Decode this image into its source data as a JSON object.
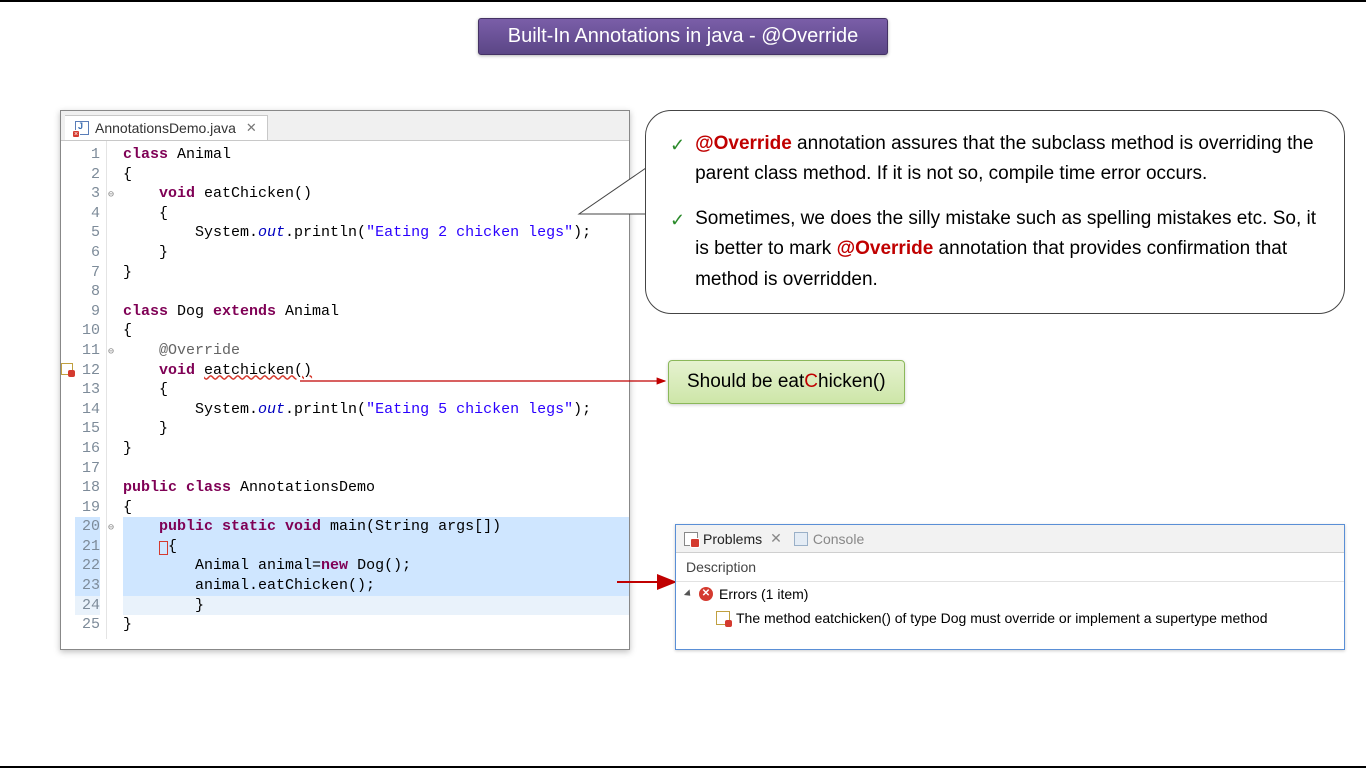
{
  "title": "Built-In Annotations in java - @Override",
  "editor": {
    "tab_label": "AnnotationsDemo.java",
    "tab_close": "✕",
    "line_count": 25,
    "lines": [
      {
        "n": 1,
        "tokens": [
          {
            "t": "class ",
            "c": "kw"
          },
          {
            "t": "Animal"
          }
        ]
      },
      {
        "n": 2,
        "tokens": [
          {
            "t": "{"
          }
        ]
      },
      {
        "n": 3,
        "fold": "⊖",
        "tokens": [
          {
            "t": "    "
          },
          {
            "t": "void ",
            "c": "kw"
          },
          {
            "t": "eatChicken()"
          }
        ]
      },
      {
        "n": 4,
        "tokens": [
          {
            "t": "    {"
          }
        ]
      },
      {
        "n": 5,
        "tokens": [
          {
            "t": "        System."
          },
          {
            "t": "out",
            "c": "stat"
          },
          {
            "t": ".println("
          },
          {
            "t": "\"Eating 2 chicken legs\"",
            "c": "str"
          },
          {
            "t": ");"
          }
        ]
      },
      {
        "n": 6,
        "tokens": [
          {
            "t": "    }"
          }
        ]
      },
      {
        "n": 7,
        "tokens": [
          {
            "t": "}"
          }
        ]
      },
      {
        "n": 8,
        "tokens": [
          {
            "t": ""
          }
        ]
      },
      {
        "n": 9,
        "tokens": [
          {
            "t": "class ",
            "c": "kw"
          },
          {
            "t": "Dog "
          },
          {
            "t": "extends ",
            "c": "kw"
          },
          {
            "t": "Animal"
          }
        ]
      },
      {
        "n": 10,
        "tokens": [
          {
            "t": "{"
          }
        ]
      },
      {
        "n": 11,
        "fold": "⊖",
        "tokens": [
          {
            "t": "    "
          },
          {
            "t": "@Override",
            "c": "ann"
          }
        ]
      },
      {
        "n": 12,
        "mark": "err",
        "tokens": [
          {
            "t": "    "
          },
          {
            "t": "void ",
            "c": "kw"
          },
          {
            "t": "eatchicken()",
            "c": "underline-err"
          }
        ]
      },
      {
        "n": 13,
        "tokens": [
          {
            "t": "    {"
          }
        ]
      },
      {
        "n": 14,
        "tokens": [
          {
            "t": "        System."
          },
          {
            "t": "out",
            "c": "stat"
          },
          {
            "t": ".println("
          },
          {
            "t": "\"Eating 5 chicken legs\"",
            "c": "str"
          },
          {
            "t": ");"
          }
        ]
      },
      {
        "n": 15,
        "tokens": [
          {
            "t": "    }"
          }
        ]
      },
      {
        "n": 16,
        "tokens": [
          {
            "t": "}"
          }
        ]
      },
      {
        "n": 17,
        "tokens": [
          {
            "t": ""
          }
        ]
      },
      {
        "n": 18,
        "tokens": [
          {
            "t": "public class ",
            "c": "kw"
          },
          {
            "t": "AnnotationsDemo"
          }
        ]
      },
      {
        "n": 19,
        "tokens": [
          {
            "t": "{"
          }
        ]
      },
      {
        "n": 20,
        "fold": "⊖",
        "hl": "blue",
        "tokens": [
          {
            "t": "    "
          },
          {
            "t": "public static void ",
            "c": "kw"
          },
          {
            "t": "main(String args[])"
          }
        ]
      },
      {
        "n": 21,
        "hl": "blue",
        "redbox": true,
        "tokens": [
          {
            "t": "    "
          }
        ]
      },
      {
        "n": 22,
        "hl": "blue",
        "tokens": [
          {
            "t": "        Animal animal="
          },
          {
            "t": "new ",
            "c": "kw"
          },
          {
            "t": "Dog();"
          }
        ]
      },
      {
        "n": 23,
        "hl": "blue",
        "tokens": [
          {
            "t": "        animal.eatChicken();"
          }
        ]
      },
      {
        "n": 24,
        "hl": "line",
        "tokens": [
          {
            "t": "        }"
          }
        ]
      },
      {
        "n": 25,
        "tokens": [
          {
            "t": "}"
          }
        ]
      }
    ]
  },
  "bubble": {
    "items": [
      {
        "pre": "",
        "strong": "@Override",
        "post": " annotation assures that the subclass method is overriding the parent class method. If it is not so, compile time error occurs."
      },
      {
        "pre": "Sometimes, we does the silly mistake such as spelling mistakes etc. So, it is better to mark ",
        "strong": "@Override",
        "post": " annotation that provides confirmation that method is overridden."
      }
    ]
  },
  "green_callout": {
    "pre": "Should be eat",
    "red": "C",
    "post": "hicken()"
  },
  "problems": {
    "tab_problems": "Problems",
    "tab_console": "Console",
    "tab_close": "✕",
    "header": "Description",
    "errors_label": "Errors (1 item)",
    "error_text": "The method eatchicken() of type Dog must override or implement a supertype method"
  }
}
